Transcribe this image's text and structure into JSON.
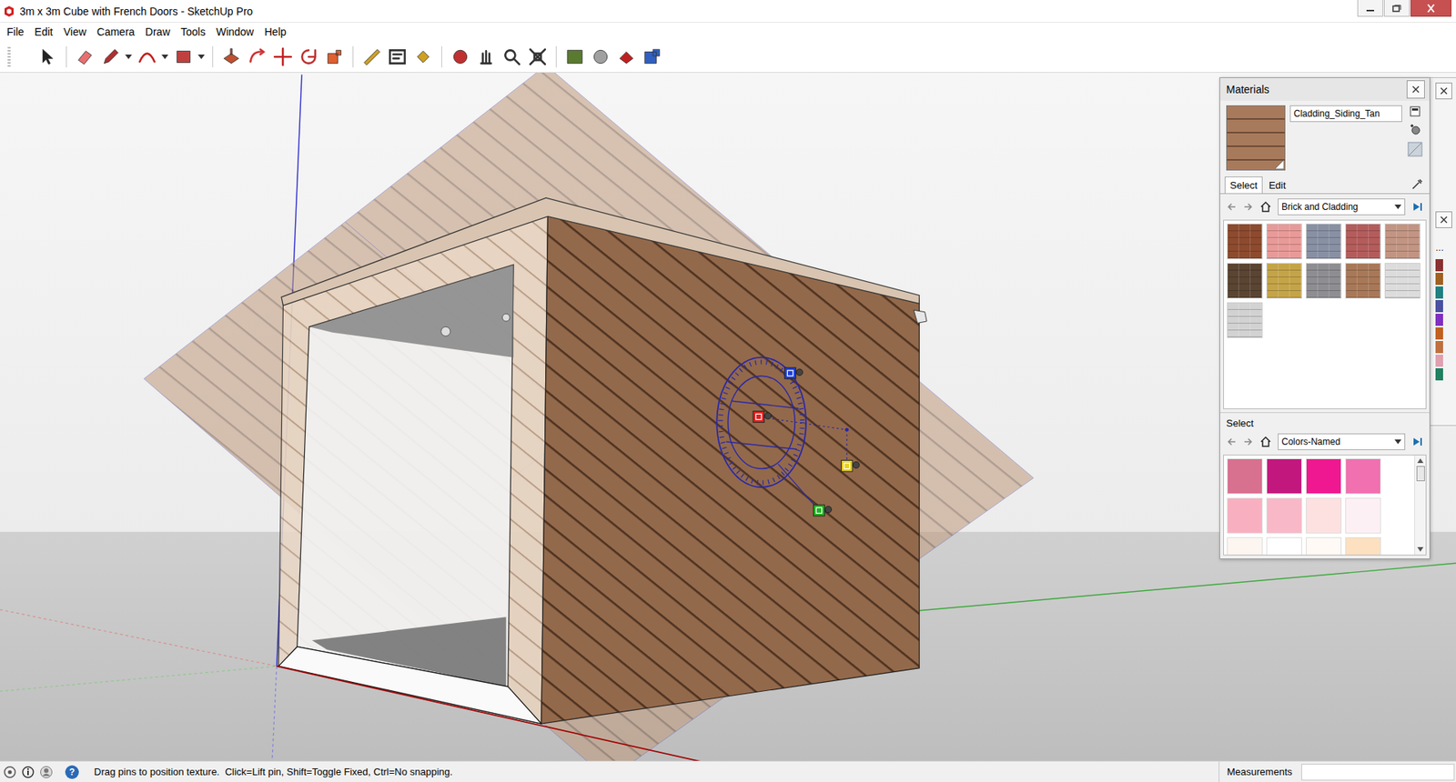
{
  "window": {
    "title": "3m x 3m Cube with French Doors - SketchUp Pro"
  },
  "menu": [
    "File",
    "Edit",
    "View",
    "Camera",
    "Draw",
    "Tools",
    "Window",
    "Help"
  ],
  "materials": {
    "title": "Materials",
    "name": "Cladding_Siding_Tan",
    "preview_color": "#a87a5c",
    "tabs": [
      {
        "label": "Select",
        "selected": true
      },
      {
        "label": "Edit",
        "selected": false
      }
    ],
    "library": "Brick and Cladding",
    "swatches": [
      {
        "color": "#8d4a2e"
      },
      {
        "color": "#e89a98"
      },
      {
        "color": "#8890a4"
      },
      {
        "color": "#b45c5c"
      },
      {
        "color": "#c29482"
      },
      {
        "color": "#5a4432"
      },
      {
        "color": "#c4a448"
      },
      {
        "color": "#8e8e92"
      },
      {
        "color": "#a87858"
      },
      {
        "color": "#dcdcdc"
      },
      {
        "color": "#d2d2d2"
      }
    ],
    "second": {
      "label": "Select",
      "library": "Colors-Named",
      "swatches": [
        {
          "color": "#d87090"
        },
        {
          "color": "#c2187e"
        },
        {
          "color": "#f01890"
        },
        {
          "color": "#f070b0"
        },
        {
          "color": "#f8b0c0"
        },
        {
          "color": "#f8b8c8"
        },
        {
          "color": "#fde0e0"
        },
        {
          "color": "#fdf0f4"
        },
        {
          "color": "#fdf5f0"
        },
        {
          "color": "#ffffff"
        },
        {
          "color": "#fffaf5"
        },
        {
          "color": "#fce0c0"
        }
      ]
    }
  },
  "background_panel": {
    "text": "...",
    "swatches": [
      "#8a3030",
      "#a06020",
      "#208080",
      "#4a50a0",
      "#8030c0",
      "#c06020",
      "#c07040",
      "#e0a0b0",
      "#208060"
    ]
  },
  "texture_pins": [
    {
      "color": "#e02020"
    },
    {
      "color": "#1c3fd8"
    },
    {
      "color": "#e8d020"
    },
    {
      "color": "#20b020"
    }
  ],
  "status_bar": {
    "help": "?",
    "hint": "Drag pins to position texture.  Click=Lift pin, Shift=Toggle Fixed, Ctrl=No snapping.",
    "measurements_label": "Measurements"
  }
}
